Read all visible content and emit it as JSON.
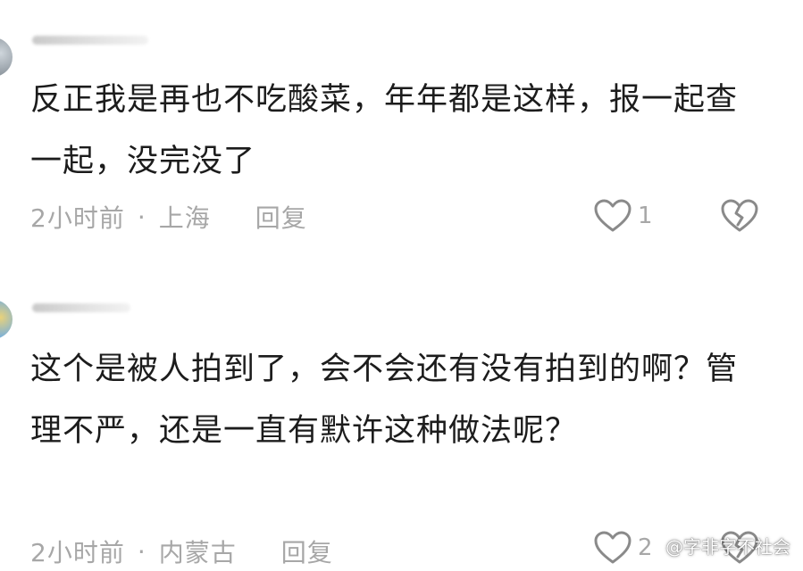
{
  "comments": [
    {
      "text": "反正我是再也不吃酸菜，年年都是这样，报一起查一起，没完没了",
      "time": "2小时前",
      "location": "上海",
      "reply_label": "回复",
      "likes": "1"
    },
    {
      "text": "这个是被人拍到了，会不会还有没有拍到的啊？管理不严，还是一直有默许这种做法呢？",
      "time": "2小时前",
      "location": "内蒙古",
      "reply_label": "回复",
      "likes": "2"
    }
  ],
  "watermark": "@字非字不社会",
  "icons": {
    "like": "heart-icon",
    "dislike": "broken-heart-icon"
  },
  "colors": {
    "meta_text": "#a7a7a7",
    "body_text": "#1c1c1c"
  }
}
